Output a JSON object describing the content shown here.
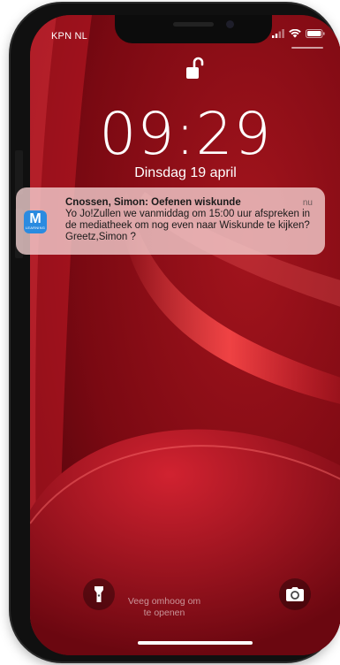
{
  "status_bar": {
    "carrier": "KPN NL",
    "icons": [
      "signal-icon",
      "wifi-icon",
      "battery-icon"
    ]
  },
  "lock_screen": {
    "lock_icon": "unlocked-padlock-icon",
    "time": "09:29",
    "date": "Dinsdag 19 april"
  },
  "notification": {
    "app_icon_letter": "M",
    "app_icon_sub": "LEARNING",
    "title": "Cnossen, Simon: Oefenen wiskunde",
    "time": "nu",
    "body": "Yo Jo!Zullen we vanmiddag om 15:00 uur afspreken in de mediatheek om nog even naar Wiskunde te kijken?Greetz,Simon ?"
  },
  "bottom": {
    "flashlight_icon": "flashlight-icon",
    "camera_icon": "camera-icon",
    "swipe_line1": "Veeg omhoog om",
    "swipe_line2": "te openen"
  },
  "colors": {
    "wallpaper_base": "#7a0912",
    "wallpaper_highlight": "#e52a36",
    "notification_bg": "#f5d2d2",
    "app_icon": "#2a8be0"
  }
}
